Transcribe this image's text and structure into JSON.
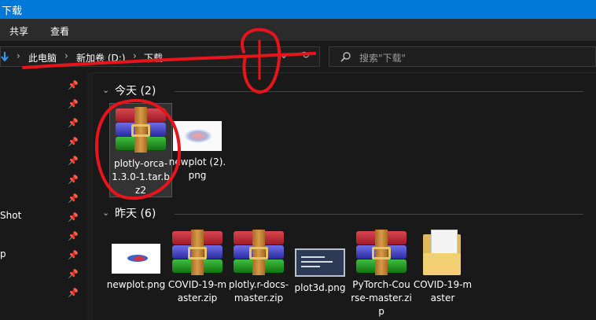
{
  "window": {
    "title": "下载"
  },
  "ribbon": {
    "tabs": [
      "共享",
      "查看"
    ]
  },
  "address": {
    "crumbs": [
      "此电脑",
      "新加卷 (D:)",
      "下载"
    ]
  },
  "search": {
    "placeholder": "搜索\"下载\""
  },
  "nav": {
    "labels": [
      "Shot",
      "p"
    ]
  },
  "groups": {
    "today": "今天 (2)",
    "yesterday": "昨天 (6)"
  },
  "files": {
    "today": [
      {
        "name": "plotly-orca-1.3.0-1.tar.bz2",
        "icon": "winrar-archive-icon"
      },
      {
        "name": "newplot (2).png",
        "icon": "image-thumbnail-icon"
      }
    ],
    "yesterday": [
      {
        "name": "newplot.png",
        "icon": "image-thumbnail-icon"
      },
      {
        "name": "COVID-19-master.zip",
        "icon": "winrar-archive-icon"
      },
      {
        "name": "plotly.r-docs-master.zip",
        "icon": "winrar-archive-icon"
      },
      {
        "name": "plot3d.png",
        "icon": "image-thumbnail-icon"
      },
      {
        "name": "PyTorch-Course-master.zip",
        "icon": "winrar-archive-icon"
      },
      {
        "name": "COVID-19-master",
        "icon": "folder-icon"
      }
    ]
  },
  "annotations": {
    "note": "1",
    "color": "#e8141b"
  }
}
